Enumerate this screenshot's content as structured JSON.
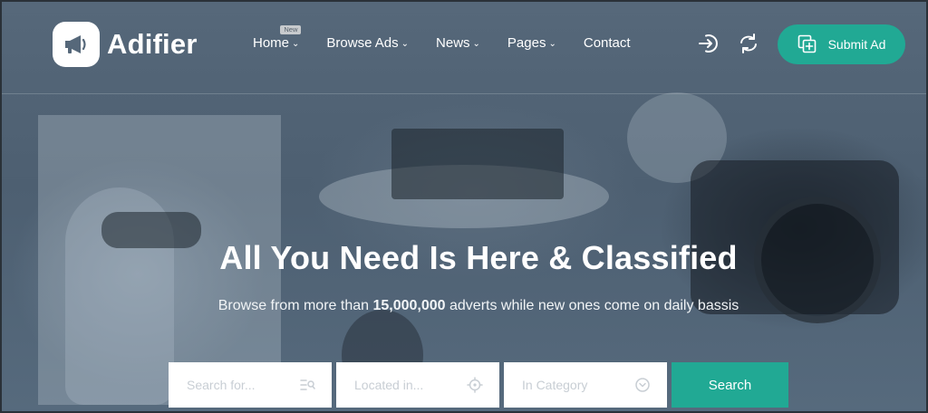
{
  "brand": {
    "name": "Adifier",
    "logo_icon": "megaphone-icon"
  },
  "nav": {
    "items": [
      {
        "label": "Home",
        "badge": "New",
        "dropdown": true
      },
      {
        "label": "Browse Ads",
        "dropdown": true
      },
      {
        "label": "News",
        "dropdown": true
      },
      {
        "label": "Pages",
        "dropdown": true
      },
      {
        "label": "Contact",
        "dropdown": false
      }
    ]
  },
  "header_actions": {
    "login_icon": "login-icon",
    "compare_icon": "sync-icon",
    "submit_label": "Submit Ad"
  },
  "hero": {
    "title": "All You Need Is Here & Classified",
    "subtitle_prefix": "Browse from more than ",
    "subtitle_count": "15,000,000",
    "subtitle_suffix": " adverts while new ones come on daily bassis"
  },
  "search": {
    "keyword_placeholder": "Search for...",
    "location_placeholder": "Located in...",
    "category_placeholder": "In Category",
    "button_label": "Search"
  },
  "colors": {
    "accent": "#21a994",
    "overlay": "#4f6275"
  }
}
